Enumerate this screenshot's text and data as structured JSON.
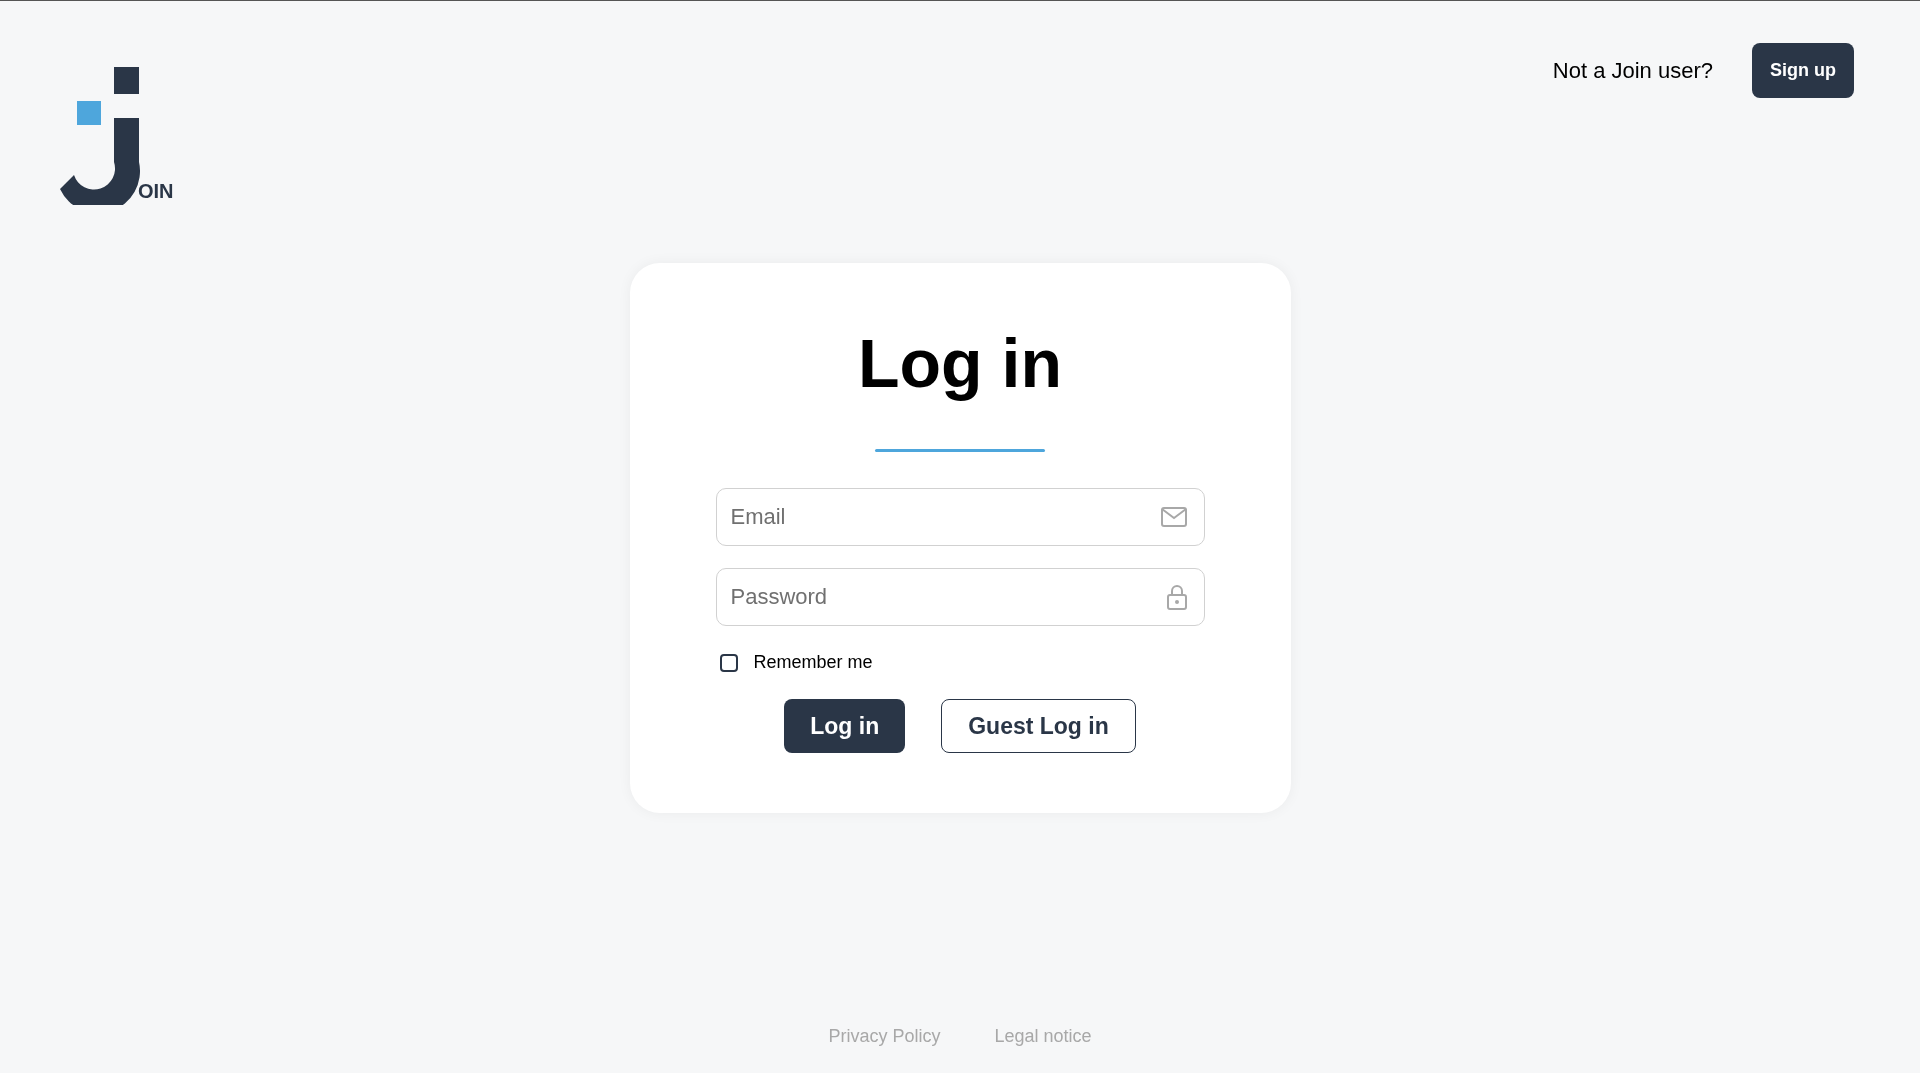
{
  "logo": {
    "text": "OIN"
  },
  "header": {
    "prompt": "Not a Join user?",
    "signup_button": "Sign up"
  },
  "login_card": {
    "title": "Log in",
    "fields": [
      {
        "kind": "email",
        "placeholder": "Email"
      },
      {
        "kind": "password",
        "placeholder": "Password"
      }
    ],
    "remember_me": {
      "label": "Remember me",
      "checked": false
    },
    "buttons": [
      {
        "kind": "primary",
        "label": "Log in"
      },
      {
        "kind": "secondary",
        "label": "Guest Log in"
      }
    ]
  },
  "footer_links": [
    "Privacy Policy",
    "Legal notice"
  ]
}
